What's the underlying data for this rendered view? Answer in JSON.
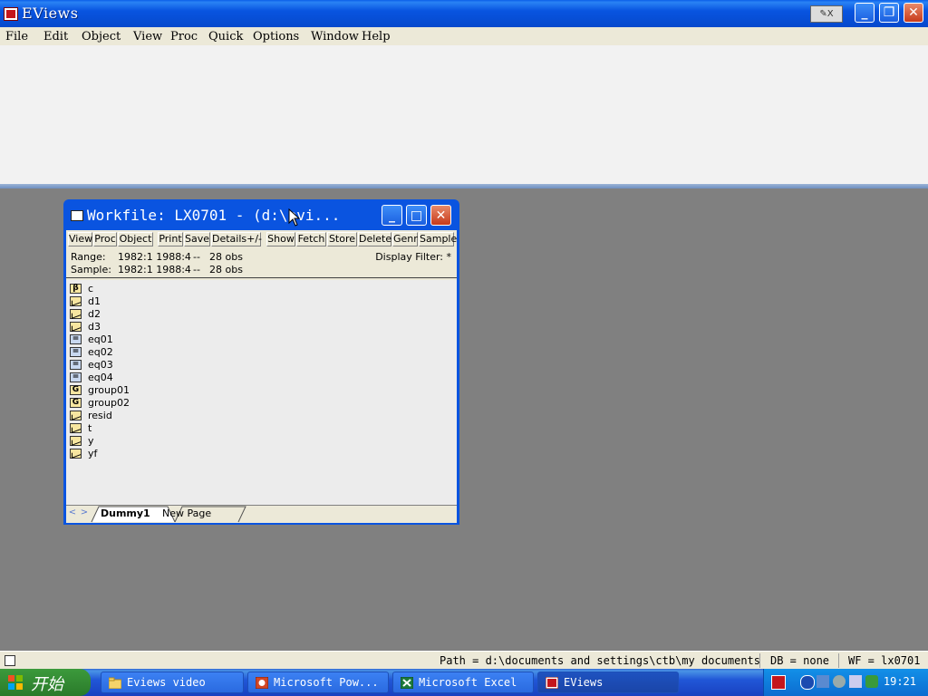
{
  "app": {
    "title": "EViews"
  },
  "window_controls": {
    "minimize": "_",
    "maximize": "❐",
    "close": "✕"
  },
  "menu": [
    "File",
    "Edit",
    "Object",
    "View",
    "Proc",
    "Quick",
    "Options",
    "Window",
    "Help"
  ],
  "workfile": {
    "title": "Workfile: LX0701 - (d:\\evi...",
    "toolbar": [
      "View",
      "Proc",
      "Object",
      "Print",
      "Save",
      "Details+/-",
      "Show",
      "Fetch",
      "Store",
      "Delete",
      "Genr",
      "Sample"
    ],
    "range_label": "Range:",
    "range_value": "1982:1 1988:4",
    "range_sep": "--",
    "range_obs": "28 obs",
    "sample_label": "Sample:",
    "sample_value": "1982:1 1988:4",
    "sample_sep": "--",
    "sample_obs": "28 obs",
    "display_filter": "Display Filter: *",
    "objects": [
      {
        "name": "c",
        "type": "coef",
        "glyph": "β"
      },
      {
        "name": "d1",
        "type": "series",
        "glyph": ""
      },
      {
        "name": "d2",
        "type": "series",
        "glyph": ""
      },
      {
        "name": "d3",
        "type": "series",
        "glyph": ""
      },
      {
        "name": "eq01",
        "type": "equation",
        "glyph": "="
      },
      {
        "name": "eq02",
        "type": "equation",
        "glyph": "="
      },
      {
        "name": "eq03",
        "type": "equation",
        "glyph": "="
      },
      {
        "name": "eq04",
        "type": "equation",
        "glyph": "="
      },
      {
        "name": "group01",
        "type": "group",
        "glyph": "G"
      },
      {
        "name": "group02",
        "type": "group",
        "glyph": "G"
      },
      {
        "name": "resid",
        "type": "series",
        "glyph": ""
      },
      {
        "name": "t",
        "type": "series",
        "glyph": ""
      },
      {
        "name": "y",
        "type": "series",
        "glyph": ""
      },
      {
        "name": "yf",
        "type": "series",
        "glyph": ""
      }
    ],
    "tabs": {
      "prev": "<",
      "next": ">",
      "active": "Dummy1",
      "new_page": "New Page"
    }
  },
  "statusbar": {
    "path": "Path = d:\\documents and settings\\ctb\\my documents",
    "db": "DB = none",
    "wf": "WF = lx0701"
  },
  "taskbar": {
    "start": "开始",
    "items": [
      {
        "label": "Eviews video",
        "icon": "folder-icon"
      },
      {
        "label": "Microsoft Pow...",
        "icon": "powerpoint-icon"
      },
      {
        "label": "Microsoft Excel",
        "icon": "excel-icon"
      },
      {
        "label": "EViews",
        "icon": "eviews-icon"
      }
    ],
    "clock": "19:21"
  },
  "colors": {
    "title_blue": "#0a54e0",
    "taskbar_blue": "#2157d7",
    "start_green": "#3c9a3c",
    "desktop_gray": "#808080"
  }
}
